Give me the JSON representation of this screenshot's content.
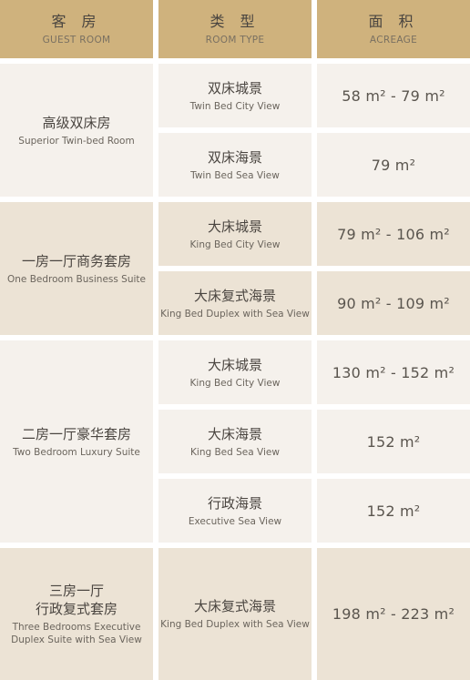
{
  "header": {
    "guest_room": {
      "zh": "客 房",
      "en": "GUEST ROOM"
    },
    "room_type": {
      "zh": "类 型",
      "en": "ROOM TYPE"
    },
    "acreage": {
      "zh": "面 积",
      "en": "ACREAGE"
    }
  },
  "groups": [
    {
      "zh": "高级双床房",
      "en": "Superior Twin-bed Room",
      "rows": [
        {
          "type_zh": "双床城景",
          "type_en": "Twin Bed City View",
          "area": "58 m² - 79 m²"
        },
        {
          "type_zh": "双床海景",
          "type_en": "Twin Bed Sea View",
          "area": "79 m²"
        }
      ]
    },
    {
      "zh": "一房一厅商务套房",
      "en": "One Bedroom Business Suite",
      "rows": [
        {
          "type_zh": "大床城景",
          "type_en": "King Bed City View",
          "area": "79 m² - 106 m²"
        },
        {
          "type_zh": "大床复式海景",
          "type_en": "King Bed Duplex with Sea View",
          "area": "90 m² - 109 m²"
        }
      ]
    },
    {
      "zh": "二房一厅豪华套房",
      "en": "Two Bedroom Luxury Suite",
      "rows": [
        {
          "type_zh": "大床城景",
          "type_en": "King Bed City View",
          "area": "130 m² - 152 m²"
        },
        {
          "type_zh": "大床海景",
          "type_en": "King Bed Sea View",
          "area": "152 m²"
        },
        {
          "type_zh": "行政海景",
          "type_en": "Executive Sea View",
          "area": "152 m²"
        }
      ]
    },
    {
      "zh_line1": "三房一厅",
      "zh_line2": "行政复式套房",
      "en_line1": "Three Bedrooms Executive",
      "en_line2": "Duplex Suite with Sea View",
      "rows": [
        {
          "type_zh": "大床复式海景",
          "type_en": "King Bed Duplex with Sea View",
          "area": "198 m² - 223 m²"
        }
      ]
    }
  ],
  "colors": {
    "header": "#cfb27d",
    "light": "#f5f1ec",
    "dark": "#ece3d5"
  }
}
